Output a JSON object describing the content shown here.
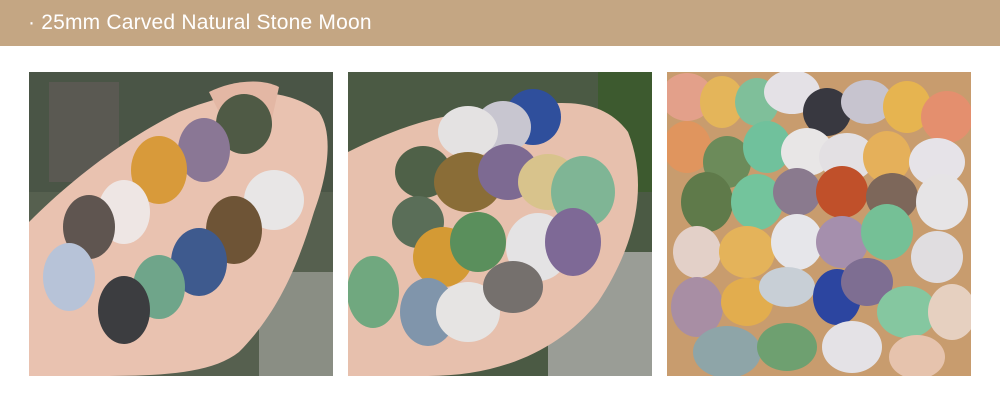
{
  "header": {
    "title": "· 25mm Carved Natural Stone Moon",
    "bg_color": "#c4a683",
    "text_color": "#ffffff"
  },
  "photos": [
    {
      "name": "photo-hand-stones-spread",
      "depicts": "hand holding carved stone moon figurines"
    },
    {
      "name": "photo-hand-stones-pile",
      "depicts": "hand holding a pile of carved stone moons"
    },
    {
      "name": "photo-stones-heap",
      "depicts": "heap of assorted carved stone moons"
    }
  ]
}
